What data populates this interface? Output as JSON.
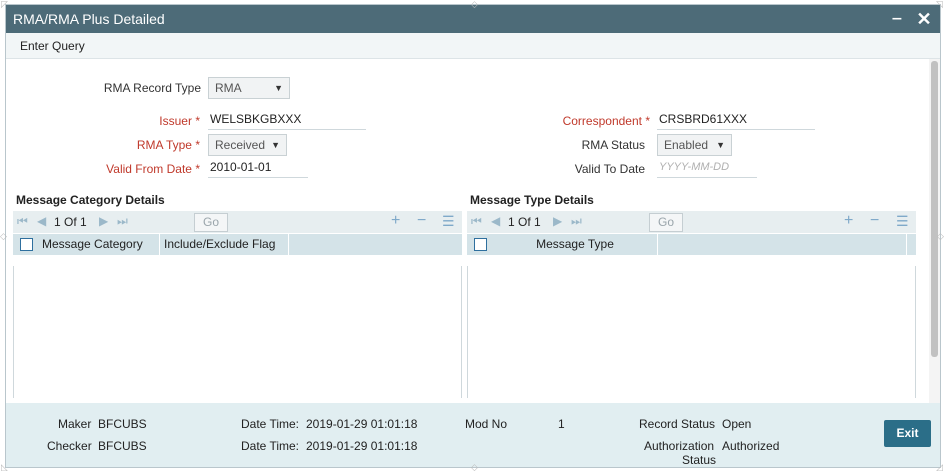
{
  "window": {
    "title": "RMA/RMA Plus Detailed",
    "minimize_label": "‒",
    "close_label": "✕"
  },
  "toolbar": {
    "enter_query": "Enter Query"
  },
  "form": {
    "rma_record_type": {
      "label": "RMA Record Type",
      "value": "RMA"
    },
    "issuer": {
      "label": "Issuer",
      "required": "*",
      "value": "WELSBKGBXXX"
    },
    "correspondent": {
      "label": "Correspondent",
      "required": "*",
      "value": "CRSBRD61XXX"
    },
    "rma_type": {
      "label": "RMA Type",
      "required": "*",
      "value": "Received"
    },
    "rma_status": {
      "label": "RMA Status",
      "value": "Enabled"
    },
    "valid_from_date": {
      "label": "Valid From Date",
      "required": "*",
      "value": "2010-01-01"
    },
    "valid_to_date": {
      "label": "Valid To Date",
      "placeholder": "YYYY-MM-DD"
    }
  },
  "message_category": {
    "title": "Message Category Details",
    "pager": "1 Of 1",
    "go_label": "Go",
    "columns": [
      "Message Category",
      "Include/Exclude Flag"
    ]
  },
  "message_type": {
    "title": "Message Type Details",
    "pager": "1 Of 1",
    "go_label": "Go",
    "columns": [
      "Message Type"
    ]
  },
  "footer": {
    "maker_label": "Maker",
    "maker_value": "BFCUBS",
    "checker_label": "Checker",
    "checker_value": "BFCUBS",
    "datetime_label": "Date Time:",
    "maker_datetime": "2019-01-29 01:01:18",
    "checker_datetime": "2019-01-29 01:01:18",
    "mod_no_label": "Mod No",
    "mod_no_value": "1",
    "record_status_label": "Record Status",
    "record_status_value": "Open",
    "auth_status_label_1": "Authorization",
    "auth_status_label_2": "Status",
    "auth_status_value": "Authorized",
    "exit_label": "Exit"
  },
  "icons": {
    "first": "⏮",
    "prev": "◀",
    "next": "▶",
    "last": "⏭",
    "add": "+",
    "remove": "−",
    "list": "☰"
  },
  "colors": {
    "titlebar": "#4d6b78",
    "required": "#c0392b",
    "grid_header": "#d4e3e8",
    "footer": "#e1eef1",
    "exit_button": "#2b6e88"
  }
}
